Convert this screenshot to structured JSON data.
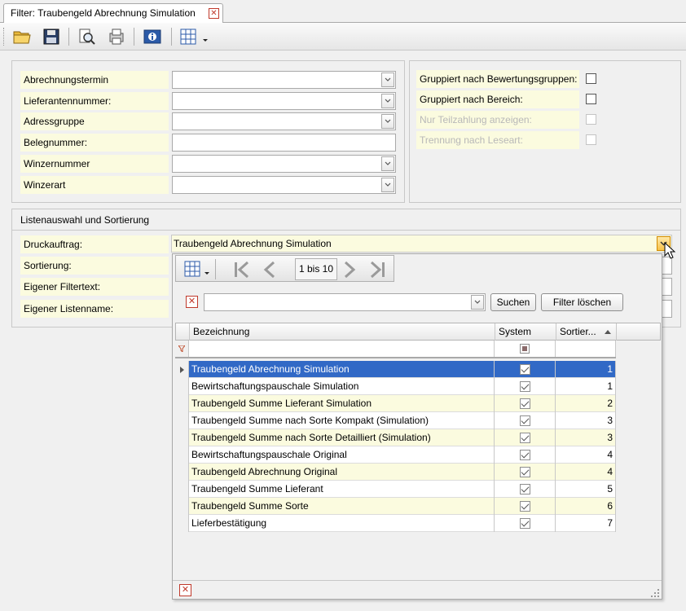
{
  "tab": {
    "title": "Filter: Traubengeld Abrechnung Simulation"
  },
  "filters_left": [
    {
      "label": "Abrechnungstermin",
      "value": "",
      "type": "combo"
    },
    {
      "label": "Lieferantennummer:",
      "value": "",
      "type": "combo"
    },
    {
      "label": "Adressgruppe",
      "value": "",
      "type": "combo"
    },
    {
      "label": "Belegnummer:",
      "value": "",
      "type": "text"
    },
    {
      "label": "Winzernummer",
      "value": "",
      "type": "combo"
    },
    {
      "label": "Winzerart",
      "value": "",
      "type": "combo"
    }
  ],
  "filters_right": [
    {
      "label": "Gruppiert nach Bewertungsgruppen:",
      "checked": false,
      "enabled": true
    },
    {
      "label": "Gruppiert nach Bereich:",
      "checked": false,
      "enabled": true
    },
    {
      "label": "Nur Teilzahlung anzeigen:",
      "checked": false,
      "enabled": false
    },
    {
      "label": "Trennung nach Leseart:",
      "checked": false,
      "enabled": false
    }
  ],
  "list_section": {
    "title": "Listenauswahl und Sortierung",
    "druckauftrag_label": "Druckauftrag:",
    "druckauftrag_value": "Traubengeld Abrechnung Simulation",
    "sortierung_label": "Sortierung:",
    "filtertext_label": "Eigener Filtertext:",
    "listenname_label": "Eigener Listenname:"
  },
  "popup": {
    "paging": "1 bis 10",
    "search_value": "",
    "search_button": "Suchen",
    "clear_button": "Filter löschen",
    "columns": {
      "name": "Bezeichnung",
      "system": "System",
      "sort": "Sortier..."
    },
    "rows": [
      {
        "name": "Traubengeld Abrechnung Simulation",
        "system": true,
        "sort": "1"
      },
      {
        "name": "Bewirtschaftungspauschale Simulation",
        "system": true,
        "sort": "1"
      },
      {
        "name": "Traubengeld Summe Lieferant Simulation",
        "system": true,
        "sort": "2"
      },
      {
        "name": "Traubengeld Summe nach Sorte Kompakt (Simulation)",
        "system": true,
        "sort": "3"
      },
      {
        "name": "Traubengeld Summe nach Sorte Detailliert (Simulation)",
        "system": true,
        "sort": "3"
      },
      {
        "name": "Bewirtschaftungspauschale Original",
        "system": true,
        "sort": "4"
      },
      {
        "name": "Traubengeld Abrechnung Original",
        "system": true,
        "sort": "4"
      },
      {
        "name": "Traubengeld Summe Lieferant",
        "system": true,
        "sort": "5"
      },
      {
        "name": "Traubengeld Summe Sorte",
        "system": true,
        "sort": "6"
      },
      {
        "name": "Lieferbestätigung",
        "system": true,
        "sort": "7"
      }
    ],
    "selected_index": 0
  },
  "colors": {
    "label_bg": "#fbfbdf",
    "selection": "#3169c6"
  }
}
